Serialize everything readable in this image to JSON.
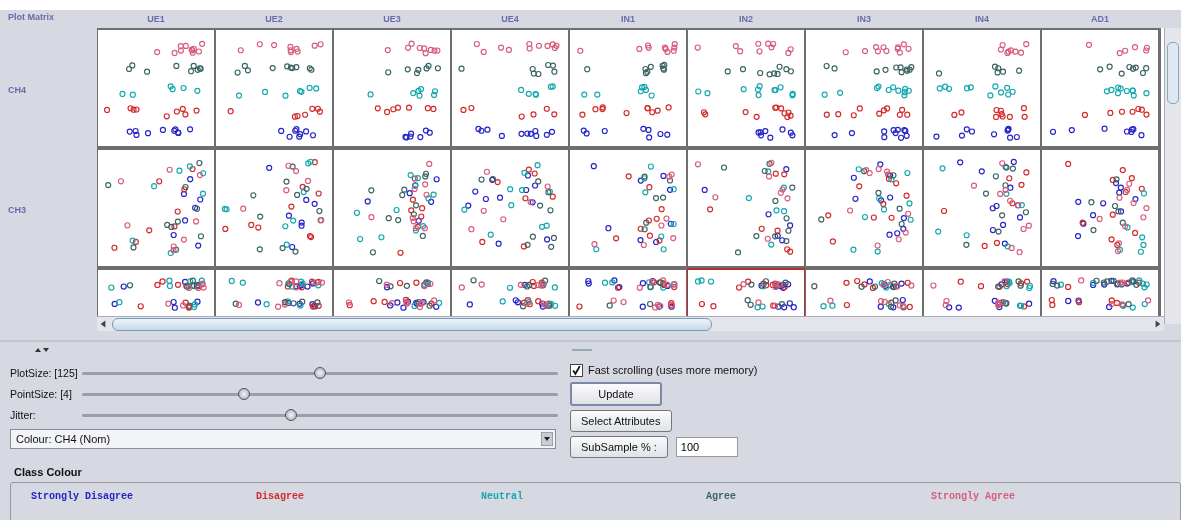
{
  "matrix": {
    "title": "Plot Matrix",
    "columns": [
      "UE1",
      "UE2",
      "UE3",
      "UE4",
      "IN1",
      "IN2",
      "IN3",
      "IN4",
      "AD1"
    ],
    "rows": [
      {
        "label": "CH4",
        "cells": [
          {
            "selected": false
          },
          {
            "selected": false
          },
          {
            "selected": false
          },
          {
            "selected": false
          },
          {
            "selected": false
          },
          {
            "selected": false
          },
          {
            "selected": false
          },
          {
            "selected": false
          },
          {
            "selected": false
          }
        ]
      },
      {
        "label": "CH3",
        "cells": [
          {
            "selected": false
          },
          {
            "selected": false
          },
          {
            "selected": false
          },
          {
            "selected": false
          },
          {
            "selected": false
          },
          {
            "selected": false
          },
          {
            "selected": false
          },
          {
            "selected": false
          },
          {
            "selected": false
          }
        ]
      },
      {
        "cells": [
          {
            "selected": false
          },
          {
            "selected": false
          },
          {
            "selected": false
          },
          {
            "selected": false
          },
          {
            "selected": false
          },
          {
            "selected": true
          },
          {
            "selected": false
          },
          {
            "selected": false
          },
          {
            "selected": false
          }
        ]
      }
    ]
  },
  "sliders": [
    {
      "label": "PlotSize: [125]",
      "level": 0.5
    },
    {
      "label": "PointSize: [4]",
      "level": 0.34
    },
    {
      "label": "Jitter:",
      "level": 0.44
    }
  ],
  "colour_dropdown": {
    "value": "Colour: CH4  (Nom)"
  },
  "fast_scrolling": {
    "label": "Fast scrolling (uses more memory)",
    "checked": true
  },
  "buttons": {
    "update": "Update",
    "select_attributes": "Select Attributes",
    "subsample": "SubSample % :"
  },
  "subsample_field": {
    "value": "100"
  },
  "class_colour": {
    "title": "Class Colour",
    "classes": [
      {
        "label": "Strongly Disagree",
        "color": "#2424c8"
      },
      {
        "label": "Disagree",
        "color": "#d42a2a"
      },
      {
        "label": "Neutral",
        "color": "#14a8b0"
      },
      {
        "label": "Agree",
        "color": "#3c6464"
      },
      {
        "label": "Strongly Agree",
        "color": "#d85c7c"
      }
    ]
  }
}
